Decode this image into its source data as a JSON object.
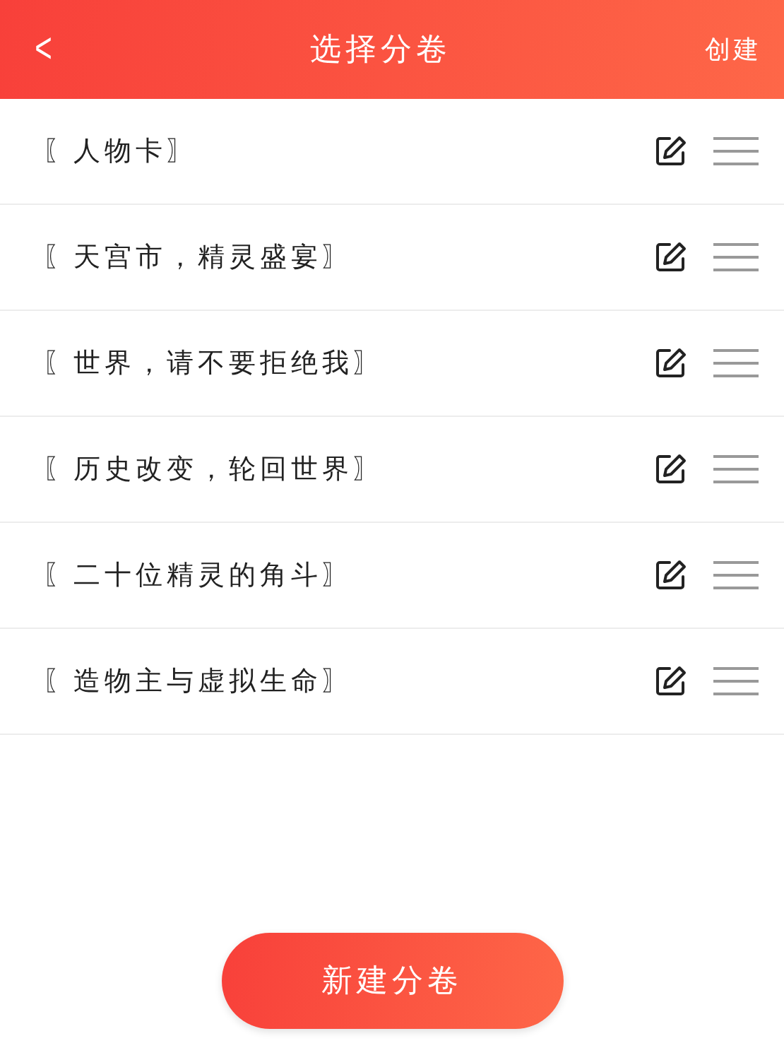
{
  "header": {
    "back": "<",
    "title": "选择分卷",
    "action": "创建"
  },
  "volumes": [
    {
      "title": "〖人物卡〗"
    },
    {
      "title": "〖天宫市，精灵盛宴〗"
    },
    {
      "title": "〖世界，请不要拒绝我〗"
    },
    {
      "title": "〖历史改变，轮回世界〗"
    },
    {
      "title": "〖二十位精灵的角斗〗"
    },
    {
      "title": "〖造物主与虚拟生命〗"
    }
  ],
  "new_button": "新建分卷"
}
